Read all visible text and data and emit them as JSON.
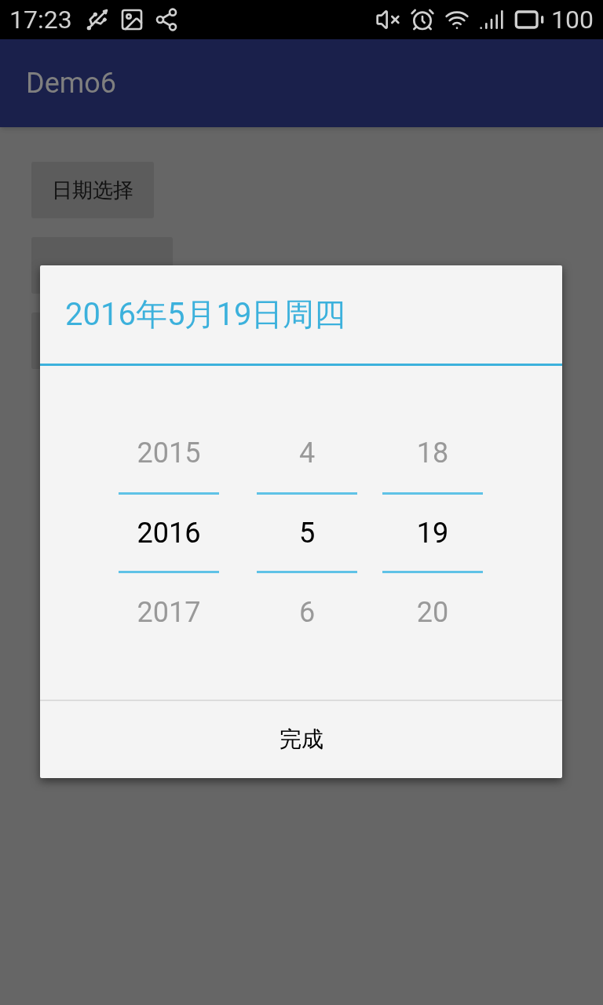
{
  "status_bar": {
    "time": "17:23",
    "battery": "100"
  },
  "app_bar": {
    "title": "Demo6"
  },
  "buttons": [
    {
      "label": "日期选择"
    }
  ],
  "dialog": {
    "title": "2016年5月19日周四",
    "columns": [
      {
        "items": [
          {
            "label": "2015",
            "selected": false
          },
          {
            "label": "2016",
            "selected": true
          },
          {
            "label": "2017",
            "selected": false
          }
        ]
      },
      {
        "items": [
          {
            "label": "4",
            "selected": false
          },
          {
            "label": "5",
            "selected": true
          },
          {
            "label": "6",
            "selected": false
          }
        ]
      },
      {
        "items": [
          {
            "label": "18",
            "selected": false
          },
          {
            "label": "19",
            "selected": true
          },
          {
            "label": "20",
            "selected": false
          }
        ]
      }
    ],
    "confirm": "完成"
  }
}
